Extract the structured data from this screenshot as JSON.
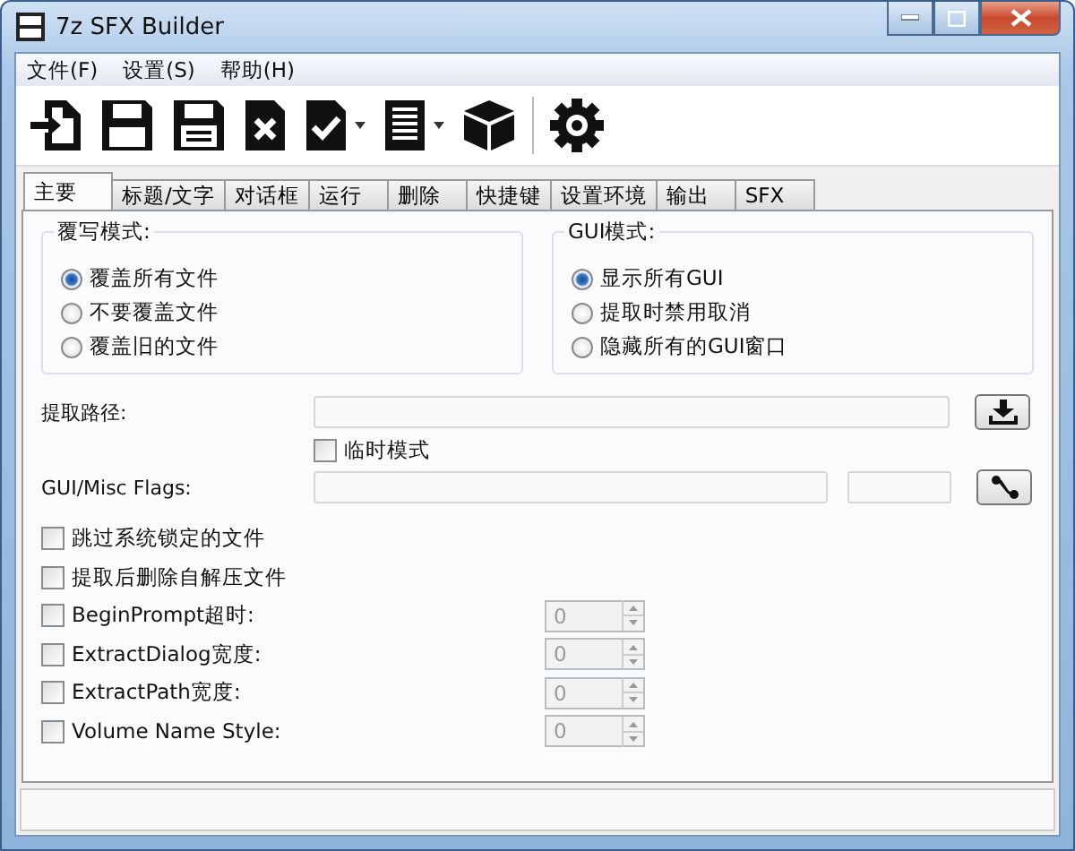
{
  "window": {
    "title": "7z SFX Builder"
  },
  "menu": [
    "文件(F)",
    "设置(S)",
    "帮助(H)"
  ],
  "tabs": [
    {
      "label": "主要",
      "selected": true
    },
    {
      "label": "标题/文字",
      "selected": false
    },
    {
      "label": "对话框",
      "selected": false
    },
    {
      "label": "运行",
      "selected": false
    },
    {
      "label": "删除",
      "selected": false
    },
    {
      "label": "快捷键",
      "selected": false
    },
    {
      "label": "设置环境",
      "selected": false
    },
    {
      "label": "输出",
      "selected": false
    },
    {
      "label": "SFX",
      "selected": false
    }
  ],
  "groups": [
    {
      "title": "覆写模式:",
      "options": [
        {
          "label": "覆盖所有文件",
          "selected": true
        },
        {
          "label": "不要覆盖文件",
          "selected": false
        },
        {
          "label": "覆盖旧的文件",
          "selected": false
        }
      ]
    },
    {
      "title": "GUI模式:",
      "options": [
        {
          "label": "显示所有GUI",
          "selected": true
        },
        {
          "label": "提取时禁用取消",
          "selected": false
        },
        {
          "label": "隐藏所有的GUI窗口",
          "selected": false
        }
      ]
    }
  ],
  "extract_path": {
    "label": "提取路径:"
  },
  "temp_mode": {
    "label": "临时模式",
    "checked": false
  },
  "flags": {
    "label": "GUI/Misc Flags:"
  },
  "options": [
    {
      "kind": "check",
      "label": "跳过系统锁定的文件",
      "checked": false
    },
    {
      "kind": "check",
      "label": "提取后删除自解压文件",
      "checked": false
    },
    {
      "kind": "spin",
      "label": "BeginPrompt超时:",
      "checked": false,
      "value": "0",
      "disabled": true
    },
    {
      "kind": "spin",
      "label": "ExtractDialog宽度:",
      "checked": false,
      "value": "0",
      "disabled": true
    },
    {
      "kind": "spin",
      "label": "ExtractPath宽度:",
      "checked": false,
      "value": "0",
      "disabled": true
    },
    {
      "kind": "spin",
      "label": "Volume Name Style:",
      "checked": false,
      "value": "0",
      "disabled": true
    }
  ]
}
